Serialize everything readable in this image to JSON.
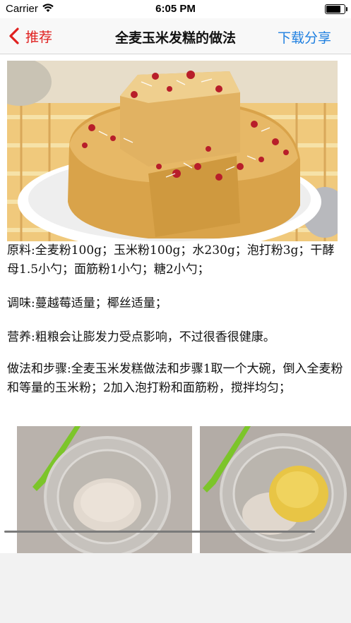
{
  "status_bar": {
    "carrier": "Carrier",
    "time": "6:05 PM"
  },
  "nav": {
    "back_label": "推荐",
    "title": "全麦玉米发糕的做法",
    "share_label": "下载分享"
  },
  "article": {
    "ingredients": "原料:全麦粉100g；玉米粉100g；水230g；泡打粉3g；干酵母1.5小勺；面筋粉1小勺；糖2小勺；",
    "seasoning": "调味:蔓越莓适量；椰丝适量；",
    "nutrition": "营养:粗粮会让膨发力受点影响，不过很香很健康。",
    "method": "做法和步骤:全麦玉米发糕做法和步骤1取一个大碗，倒入全麦粉和等量的玉米粉；2加入泡打粉和面筋粉，搅拌均匀；"
  },
  "colors": {
    "accent_red": "#e0201f",
    "link_blue": "#1e7fe0"
  }
}
